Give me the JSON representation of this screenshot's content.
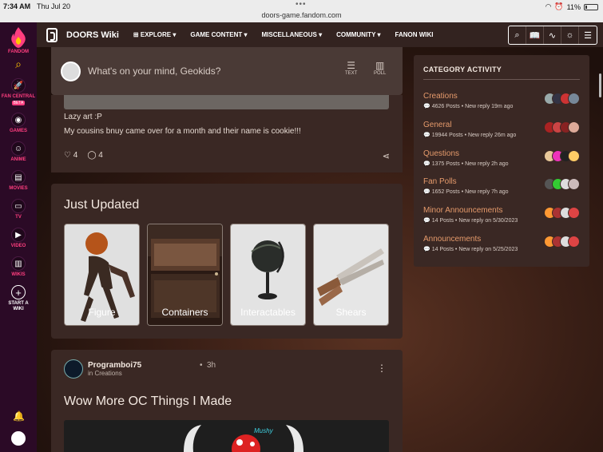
{
  "status_bar": {
    "time": "7:34 AM",
    "date": "Thu Jul 20",
    "url": "doors-game.fandom.com",
    "battery": "11%"
  },
  "rail": {
    "brand": "FANDOM",
    "items": [
      {
        "label": "FAN CENTRAL",
        "icon": "rocket-icon",
        "badge": "BETA"
      },
      {
        "label": "GAMES",
        "icon": "gamepad-icon"
      },
      {
        "label": "ANIME",
        "icon": "anime-icon"
      },
      {
        "label": "MOVIES",
        "icon": "movies-icon"
      },
      {
        "label": "TV",
        "icon": "tv-icon"
      },
      {
        "label": "VIDEO",
        "icon": "video-icon"
      },
      {
        "label": "WIKIS",
        "icon": "wikis-icon"
      },
      {
        "label": "START A WIKI",
        "icon": "plus-icon"
      }
    ]
  },
  "wiki_nav": {
    "name": "DOORS Wiki",
    "menu": [
      "EXPLORE",
      "GAME CONTENT",
      "MISCELLANEOUS",
      "COMMUNITY",
      "FANON WIKI"
    ],
    "tools": [
      "search-icon",
      "book-icon",
      "activity-icon",
      "theme-icon",
      "menu-icon"
    ]
  },
  "composer": {
    "placeholder": "What's on your mind, Geokids?",
    "text_label": "TEXT",
    "poll_label": "POLL"
  },
  "post_top": {
    "line1": "Lazy art :P",
    "line2": "My cousins bnuy came over for a month and their name is cookie!!!",
    "likes": "4",
    "comments": "4"
  },
  "just_updated": {
    "title": "Just Updated",
    "tiles": [
      "Figure",
      "Containers",
      "Interactables",
      "Shears"
    ]
  },
  "post2": {
    "author": "Programboi75",
    "age": "3h",
    "category_prefix": "in",
    "category": "Creations",
    "title": "Wow More OC Things I Made",
    "preview_label": "Mushy"
  },
  "category_activity": {
    "title": "CATEGORY ACTIVITY",
    "rows": [
      {
        "name": "Creations",
        "posts": "4626 Posts",
        "reply": "New reply 19m ago"
      },
      {
        "name": "General",
        "posts": "19944 Posts",
        "reply": "New reply 26m ago"
      },
      {
        "name": "Questions",
        "posts": "1375 Posts",
        "reply": "New reply 2h ago"
      },
      {
        "name": "Fan Polls",
        "posts": "1652 Posts",
        "reply": "New reply 7h ago"
      },
      {
        "name": "Minor Announcements",
        "posts": "14 Posts",
        "reply": "New reply on 5/30/2023"
      },
      {
        "name": "Announcements",
        "posts": "14 Posts",
        "reply": "New reply on 5/25/2023"
      }
    ]
  },
  "colors": {
    "fandom_pink": "#ff3e7f",
    "category_link": "#e59a6b",
    "card_bg": "#3a2824"
  }
}
